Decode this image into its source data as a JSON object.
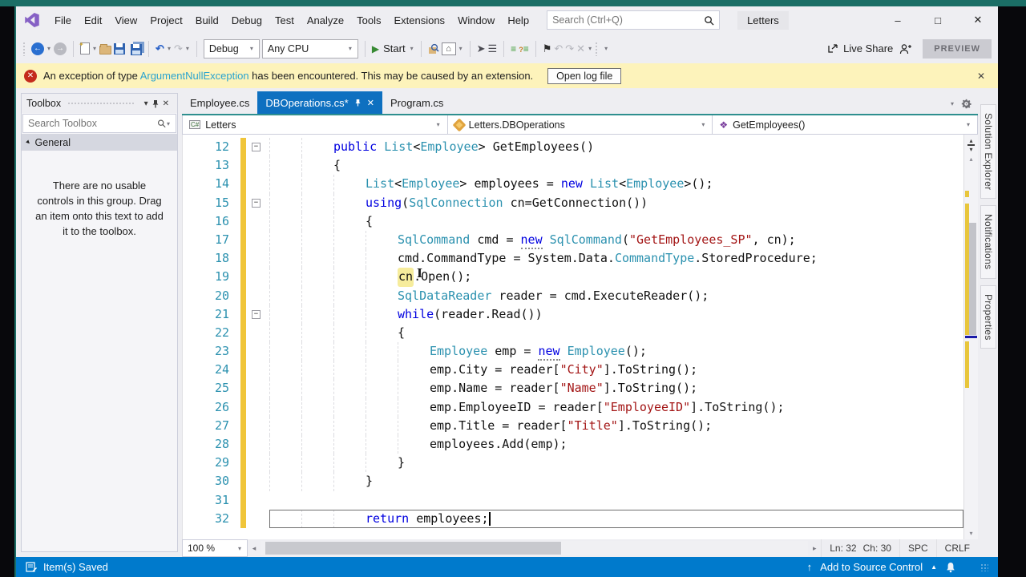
{
  "icons": {
    "chevron_down": "▾",
    "chevron_up": "▴",
    "chevron_left": "◂",
    "chevron_right": "▸",
    "minimize": "–",
    "maximize": "□",
    "close": "✕",
    "minus": "−",
    "undo": "↶",
    "redo": "↷",
    "play": "▶",
    "flag": "⚑",
    "home": "⌂",
    "back": "←",
    "forward": "→",
    "up_arrow": "↑",
    "triangle_up": "▲",
    "error_x": "✕",
    "csharp_badge": "C#",
    "indent": "≡",
    "indent2": "≡",
    "pointer": "➤",
    "outline": "☰",
    "ibeam": "I",
    "section_tri": "▾"
  },
  "titlebar": {
    "menus": [
      "File",
      "Edit",
      "View",
      "Project",
      "Build",
      "Debug",
      "Test",
      "Analyze",
      "Tools",
      "Extensions",
      "Window",
      "Help"
    ],
    "search_placeholder": "Search (Ctrl+Q)",
    "window_title": "Letters"
  },
  "toolbar": {
    "config": "Debug",
    "platform": "Any CPU",
    "start": "Start",
    "live_share": "Live Share",
    "preview": "PREVIEW"
  },
  "notification": {
    "prefix": "An exception of type ",
    "link": "ArgumentNullException",
    "suffix": " has been encountered. This may be caused by an extension.",
    "button": "Open log file"
  },
  "toolbox": {
    "title": "Toolbox",
    "search_placeholder": "Search Toolbox",
    "section": "General",
    "empty_text": "There are no usable controls in this group. Drag an item onto this text to add it to the toolbox."
  },
  "tabs": [
    {
      "label": "Employee.cs",
      "active": false
    },
    {
      "label": "DBOperations.cs*",
      "active": true
    },
    {
      "label": "Program.cs",
      "active": false
    }
  ],
  "navbar": {
    "project": "Letters",
    "type": "Letters.DBOperations",
    "member": "GetEmployees()"
  },
  "editor": {
    "zoom": "100 %",
    "current_line": 32,
    "caret_line": 32,
    "lines": [
      {
        "n": 12,
        "indent": 2,
        "fold": true,
        "tokens": [
          [
            "public ",
            "k"
          ],
          [
            "List",
            "t"
          ],
          [
            "<",
            "p"
          ],
          [
            "Employee",
            "t"
          ],
          [
            "> ",
            "p"
          ],
          [
            "GetEmployees()",
            "p"
          ]
        ]
      },
      {
        "n": 13,
        "indent": 2,
        "fold": false,
        "tokens": [
          [
            "{",
            "p"
          ]
        ]
      },
      {
        "n": 14,
        "indent": 3,
        "fold": false,
        "tokens": [
          [
            "List",
            "t"
          ],
          [
            "<",
            "p"
          ],
          [
            "Employee",
            "t"
          ],
          [
            "> employees = ",
            "p"
          ],
          [
            "new ",
            "k"
          ],
          [
            "List",
            "t"
          ],
          [
            "<",
            "p"
          ],
          [
            "Employee",
            "t"
          ],
          [
            ">();",
            "p"
          ]
        ]
      },
      {
        "n": 15,
        "indent": 3,
        "fold": true,
        "tokens": [
          [
            "using",
            "k"
          ],
          [
            "(",
            "p"
          ],
          [
            "SqlConnection",
            "t"
          ],
          [
            " cn=GetConnection())",
            "p"
          ]
        ]
      },
      {
        "n": 16,
        "indent": 3,
        "fold": false,
        "tokens": [
          [
            "{",
            "p"
          ]
        ]
      },
      {
        "n": 17,
        "indent": 4,
        "fold": false,
        "tokens": [
          [
            "SqlCommand",
            "t"
          ],
          [
            " cmd = ",
            "p"
          ],
          [
            "new",
            "k u"
          ],
          [
            " ",
            "p"
          ],
          [
            "SqlCommand",
            "t"
          ],
          [
            "(",
            "p"
          ],
          [
            "\"GetEmployees_SP\"",
            "s"
          ],
          [
            ", cn);",
            "p"
          ]
        ]
      },
      {
        "n": 18,
        "indent": 4,
        "fold": false,
        "tokens": [
          [
            "cmd.CommandType = System.Data.",
            "p"
          ],
          [
            "CommandType",
            "t"
          ],
          [
            ".StoredProcedure;",
            "p"
          ]
        ]
      },
      {
        "n": 19,
        "indent": 4,
        "fold": false,
        "tokens": [
          [
            "cn",
            "p hl"
          ],
          [
            ".Open();",
            "p"
          ]
        ]
      },
      {
        "n": 20,
        "indent": 4,
        "fold": false,
        "tokens": [
          [
            "SqlDataReader",
            "t"
          ],
          [
            " reader = cmd.ExecuteReader();",
            "p"
          ]
        ]
      },
      {
        "n": 21,
        "indent": 4,
        "fold": true,
        "tokens": [
          [
            "while",
            "k"
          ],
          [
            "(reader.Read())",
            "p"
          ]
        ]
      },
      {
        "n": 22,
        "indent": 4,
        "fold": false,
        "tokens": [
          [
            "{",
            "p"
          ]
        ]
      },
      {
        "n": 23,
        "indent": 5,
        "fold": false,
        "tokens": [
          [
            "Employee",
            "t"
          ],
          [
            " emp = ",
            "p"
          ],
          [
            "new",
            "k u"
          ],
          [
            " ",
            "p"
          ],
          [
            "Employee",
            "t"
          ],
          [
            "();",
            "p"
          ]
        ]
      },
      {
        "n": 24,
        "indent": 5,
        "fold": false,
        "tokens": [
          [
            "emp.City = reader[",
            "p"
          ],
          [
            "\"City\"",
            "s"
          ],
          [
            "].ToString();",
            "p"
          ]
        ]
      },
      {
        "n": 25,
        "indent": 5,
        "fold": false,
        "tokens": [
          [
            "emp.Name = reader[",
            "p"
          ],
          [
            "\"Name\"",
            "s"
          ],
          [
            "].ToString();",
            "p"
          ]
        ]
      },
      {
        "n": 26,
        "indent": 5,
        "fold": false,
        "tokens": [
          [
            "emp.EmployeeID = reader[",
            "p"
          ],
          [
            "\"EmployeeID\"",
            "s"
          ],
          [
            "].ToString();",
            "p"
          ]
        ]
      },
      {
        "n": 27,
        "indent": 5,
        "fold": false,
        "tokens": [
          [
            "emp.Title = reader[",
            "p"
          ],
          [
            "\"Title\"",
            "s"
          ],
          [
            "].ToString();",
            "p"
          ]
        ]
      },
      {
        "n": 28,
        "indent": 5,
        "fold": false,
        "tokens": [
          [
            "employees.Add(emp);",
            "p"
          ]
        ]
      },
      {
        "n": 29,
        "indent": 4,
        "fold": false,
        "tokens": [
          [
            "}",
            "p"
          ]
        ]
      },
      {
        "n": 30,
        "indent": 3,
        "fold": false,
        "tokens": [
          [
            "}",
            "p"
          ]
        ]
      },
      {
        "n": 31,
        "indent": 0,
        "fold": false,
        "tokens": []
      },
      {
        "n": 32,
        "indent": 3,
        "fold": false,
        "tokens": [
          [
            "return",
            "k"
          ],
          [
            " employees;",
            "p"
          ]
        ]
      }
    ]
  },
  "editor_status": {
    "ln": "Ln: 32",
    "ch": "Ch: 30",
    "spc": "SPC",
    "crlf": "CRLF"
  },
  "side_tabs": [
    "Solution Explorer",
    "Notifications",
    "Properties"
  ],
  "statusbar": {
    "message": "Item(s) Saved",
    "source_control": "Add to Source Control"
  },
  "colors": {
    "accent": "#007acc",
    "active_tab": "#0e70c0",
    "keyword": "#0000e0",
    "type": "#2b91af",
    "string": "#a31515",
    "line_number": "#2b91af",
    "change_bar": "#f0c53a",
    "notification_bg": "#fdf3bb",
    "title_teal": "#1b6e66"
  }
}
